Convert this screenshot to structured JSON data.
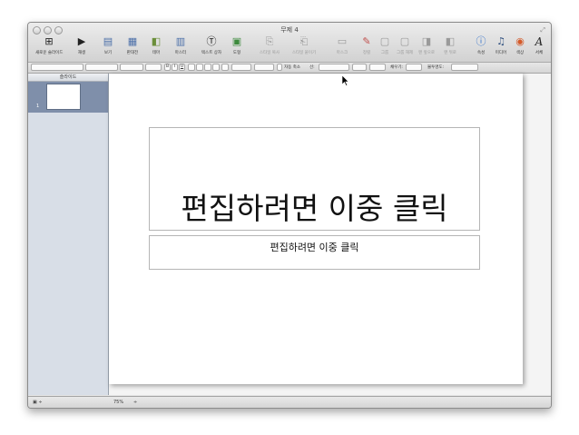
{
  "window": {
    "title": "무제 4",
    "resize_glyph": "⤢"
  },
  "toolbar": {
    "items": [
      {
        "label": "새로운 슬라이드",
        "icon": "⊞"
      },
      {
        "label": "재생",
        "icon": "▶"
      },
      {
        "label": "보기",
        "icon": "▤"
      },
      {
        "label": "판대전",
        "icon": "▦"
      },
      {
        "label": "테마",
        "icon": "◧"
      },
      {
        "label": "마스터",
        "icon": "▥"
      },
      {
        "label": "텍스트 상자",
        "icon": "Ⓣ"
      },
      {
        "label": "도형",
        "icon": "▣"
      },
      {
        "label": "스타일 복사",
        "icon": "⎘"
      },
      {
        "label": "스타일 붙이기",
        "icon": "⎗"
      },
      {
        "label": "마스크",
        "icon": "▭"
      },
      {
        "label": "정렬",
        "icon": "✎"
      },
      {
        "label": "그룹",
        "icon": "▢"
      },
      {
        "label": "그룹 해제",
        "icon": "▢"
      },
      {
        "label": "맨 앞으로",
        "icon": "◨"
      },
      {
        "label": "맨 뒤로",
        "icon": "◧"
      },
      {
        "label": "속성",
        "icon": "ⓘ"
      },
      {
        "label": "미디어",
        "icon": "♫"
      },
      {
        "label": "색상",
        "icon": "◉"
      },
      {
        "label": "서체",
        "icon": "A"
      }
    ]
  },
  "formatbar": {
    "bold": "B",
    "italic": "I",
    "underline": "U",
    "autofit_label": "자동 축소",
    "line_label": "선:",
    "fill_label": "채우기:",
    "opacity_label": "불투명도:"
  },
  "navigator": {
    "header": "슬라이드",
    "slide_number": "1"
  },
  "slide": {
    "title_placeholder": "편집하려면 이중 클릭",
    "subtitle_placeholder": "편집하려면 이중 클릭"
  },
  "statusbar": {
    "view_control": "▣ ÷",
    "zoom": "75%",
    "zoom_stepper": "÷"
  }
}
